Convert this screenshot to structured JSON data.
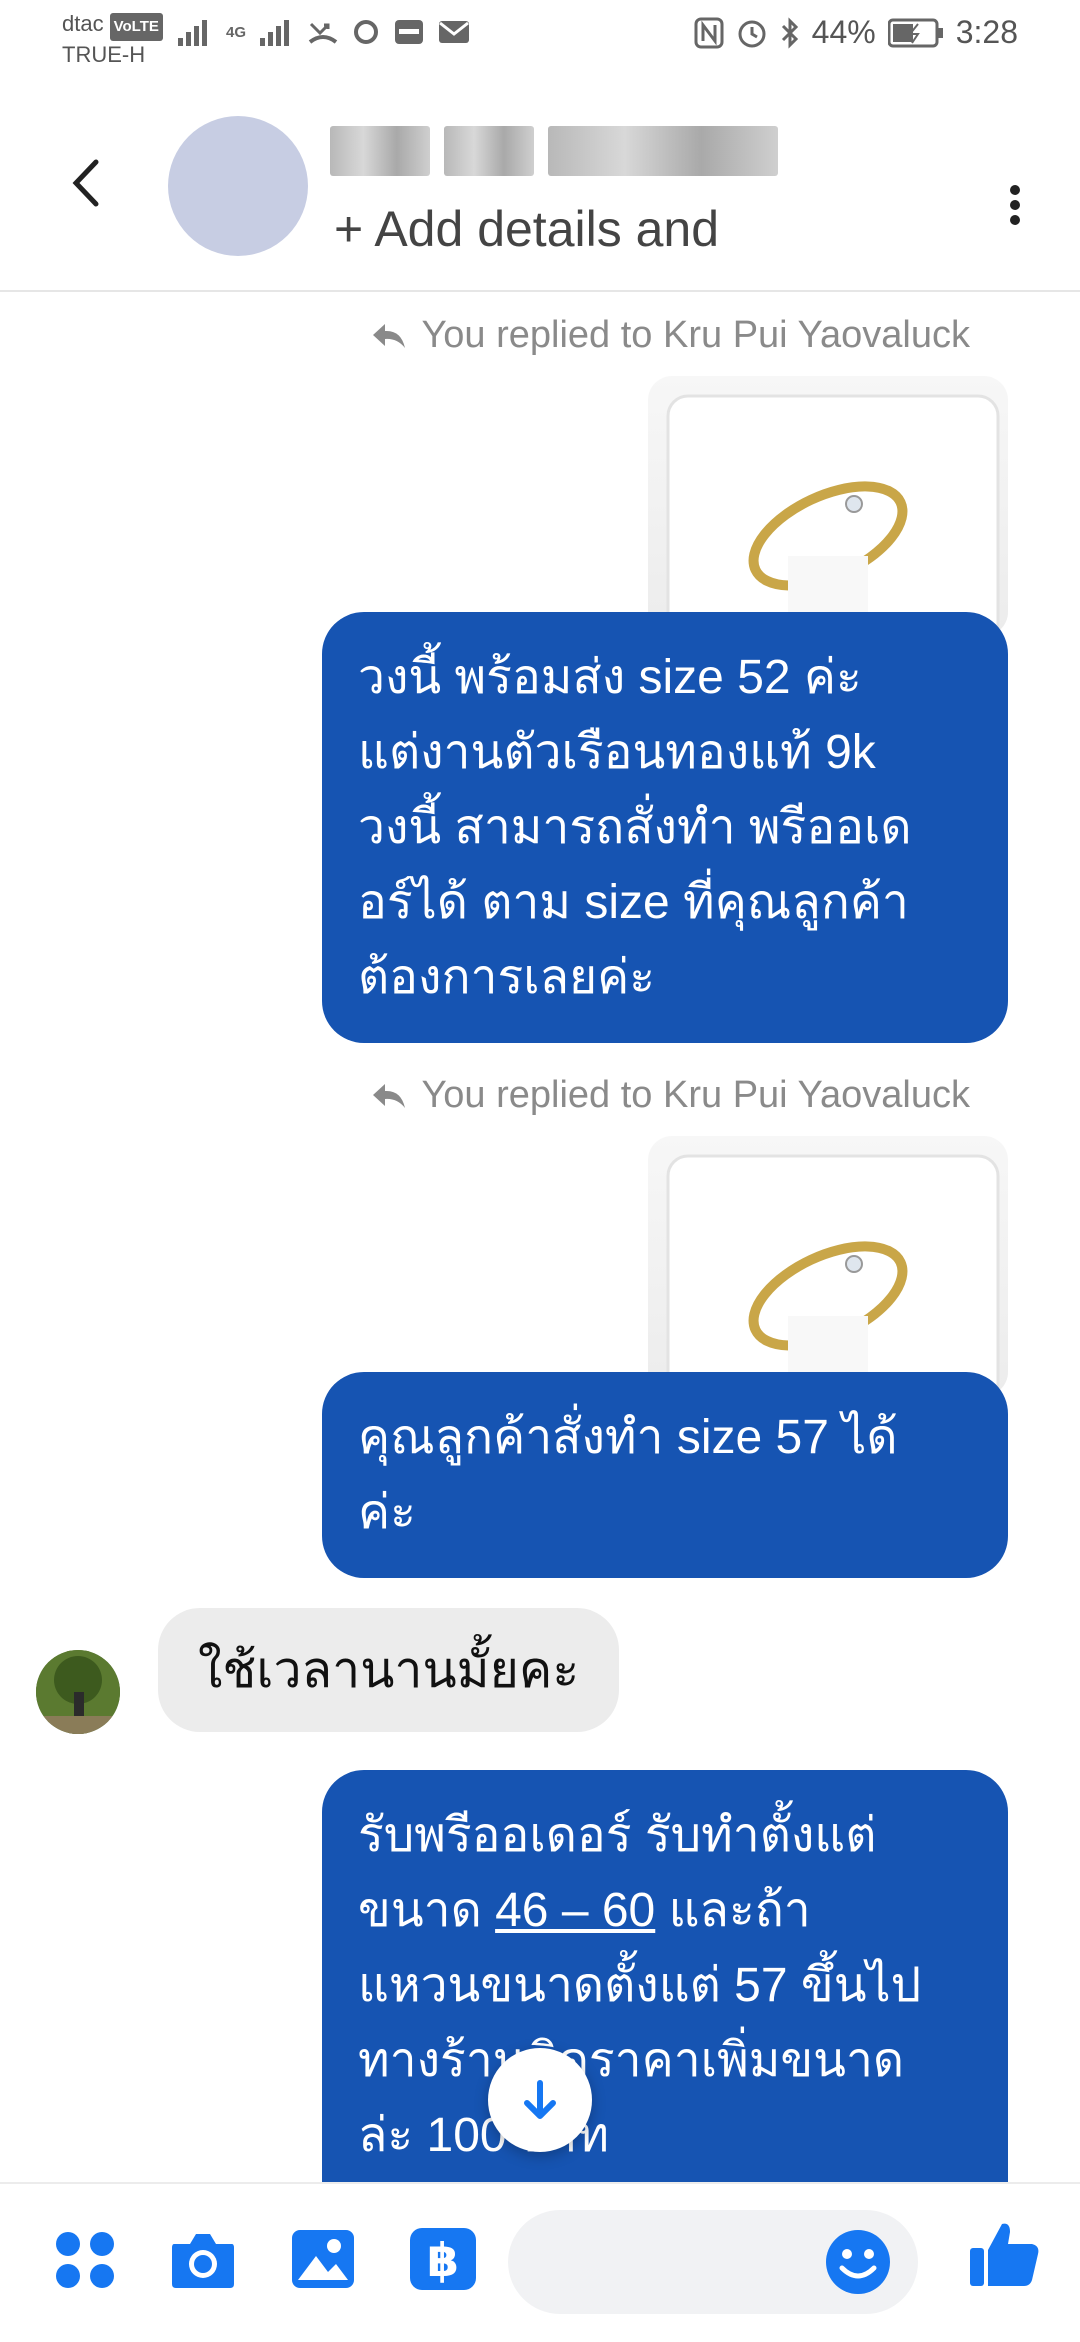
{
  "status_bar": {
    "carrier": "dtac",
    "volte": "VoLTE",
    "carrier2": "TRUE-H",
    "network": "4G",
    "battery": "44%",
    "time": "3:28"
  },
  "header": {
    "subtitle": "+ Add details and"
  },
  "messages": [
    {
      "type": "reply_label",
      "text": "You replied to Kru Pui Yaovaluck"
    },
    {
      "type": "out",
      "text": "วงนี้ พร้อมส่ง size 52 ค่ะ\nแต่งานตัวเรือนทองแท้ 9k\nวงนี้ สามารถสั่งทำ พรีออเด\nอร์ได้ ตาม size ที่คุณลูกค้า\nต้องการเลยค่ะ"
    },
    {
      "type": "reply_label",
      "text": "You replied to Kru Pui Yaovaluck"
    },
    {
      "type": "out",
      "text": "คุณลูกค้าสั่งทำ size 57 ได้\nค่ะ"
    },
    {
      "type": "in",
      "text": "ใช้เวลานานมั้ยคะ"
    },
    {
      "type": "out",
      "line1": "รับพรีออเดอร์ รับทำตั้งแต่",
      "line2_pre": "ขนาด ",
      "line2_link": "46 – 60",
      "line2_post": " และถ้า",
      "line3": "แหวนขนาดตั้งแต่ 57 ขึ้นไป",
      "line4": "ทางร้านคิดราคาเพิ่มขนาด",
      "line5": "ล่ะ 100 บาท"
    }
  ],
  "icons": {
    "back": "chevron-left-icon",
    "more": "more-vertical-icon",
    "scroll_down": "arrow-down-icon",
    "apps": "four-dots-icon",
    "camera": "camera-icon",
    "gallery": "image-icon",
    "payment": "baht-icon",
    "emoji": "smiley-icon",
    "like": "thumbs-up-icon"
  },
  "colors": {
    "accent": "#1677f2",
    "bubble_out": "#1654b2",
    "bubble_in": "#ececec"
  }
}
